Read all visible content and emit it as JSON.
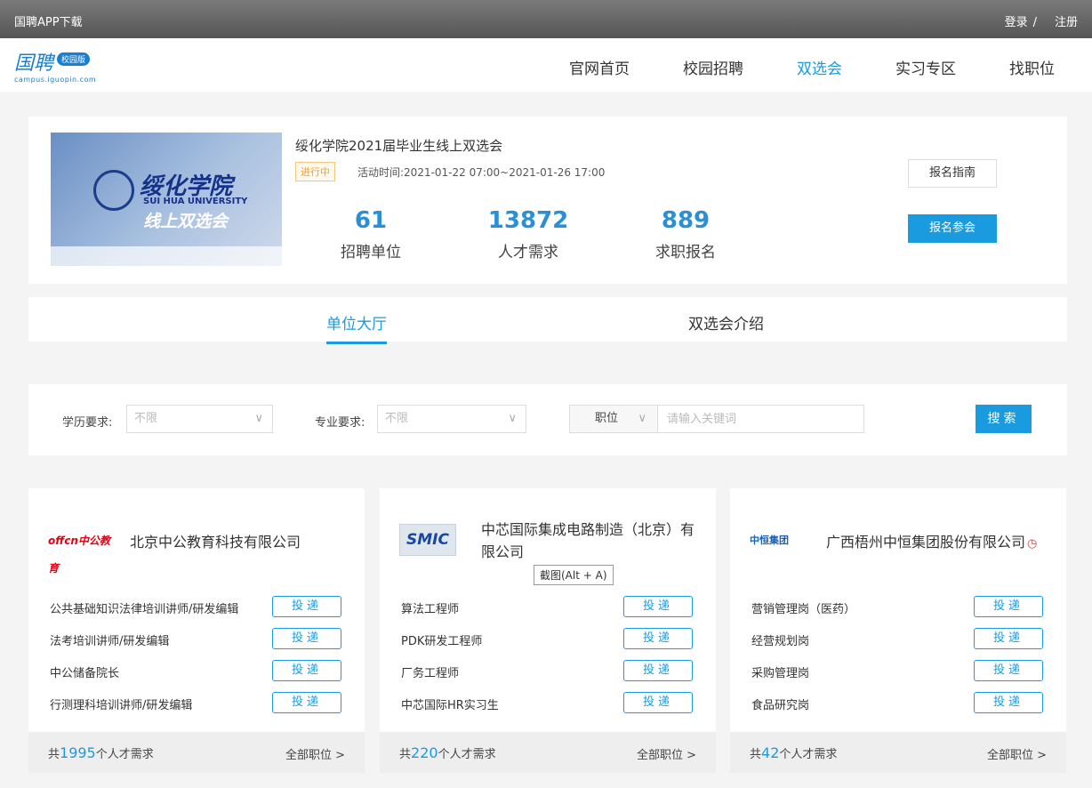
{
  "topbar": {
    "app_download": "国聘APP下载",
    "login": "登录",
    "separator": "/",
    "register": "注册"
  },
  "logo": {
    "text": "国聘",
    "badge": "校园版",
    "url": "campus.iguopin.com"
  },
  "nav": {
    "items": [
      "官网首页",
      "校园招聘",
      "双选会",
      "实习专区",
      "找职位"
    ],
    "active_index": 2
  },
  "event": {
    "banner": {
      "school_cn": "绥化学院",
      "school_en": "SUI HUA UNIVERSITY",
      "subtitle": "线上双选会"
    },
    "title": "绥化学院2021届毕业生线上双选会",
    "status": "进行中",
    "time": "活动时间:2021-01-22 07:00~2021-01-26 17:00",
    "stats": [
      {
        "value": "61",
        "label": "招聘单位"
      },
      {
        "value": "13872",
        "label": "人才需求"
      },
      {
        "value": "889",
        "label": "求职报名"
      }
    ],
    "guide_button": "报名指南",
    "join_button": "报名参会"
  },
  "tabs": {
    "units_hall": "单位大厅",
    "intro": "双选会介绍"
  },
  "filters": {
    "education_label": "学历要求:",
    "education_value": "不限",
    "major_label": "专业要求:",
    "major_value": "不限",
    "type_value": "职位",
    "keyword_placeholder": "请输入关键词",
    "search_button": "搜索"
  },
  "companies": [
    {
      "logo_text": "offcn中公教育",
      "name": "北京中公教育科技有限公司",
      "jobs": [
        "公共基础知识法律培训讲师/研发编辑",
        "法考培训讲师/研发编辑",
        "中公储备院长",
        "行测理科培训讲师/研发编辑"
      ],
      "demand_prefix": "共",
      "demand": "1995",
      "demand_suffix": "个人才需求",
      "all_jobs": "全部职位 >"
    },
    {
      "logo_text": "SMIC",
      "name": "中芯国际集成电路制造（北京）有限公司",
      "jobs": [
        "算法工程师",
        "PDK研发工程师",
        "厂务工程师",
        "中芯国际HR实习生"
      ],
      "demand_prefix": "共",
      "demand": "220",
      "demand_suffix": "个人才需求",
      "all_jobs": "全部职位 >"
    },
    {
      "logo_text": "中恒集团",
      "name": "广西梧州中恒集团股份有限公司",
      "jobs": [
        "营销管理岗（医药）",
        "经营规划岗",
        "采购管理岗",
        "食品研究岗"
      ],
      "demand_prefix": "共",
      "demand": "42",
      "demand_suffix": "个人才需求",
      "all_jobs": "全部职位 >"
    }
  ],
  "apply_label": "投递",
  "tooltip": "截图(Alt + A)",
  "colors": {
    "accent": "#1a9be0",
    "status": "#f0a030"
  }
}
